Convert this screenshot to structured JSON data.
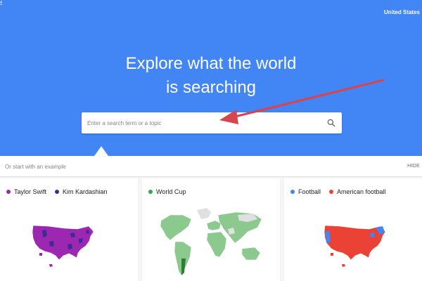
{
  "header": {
    "edge_text": "s",
    "country": "United States"
  },
  "hero": {
    "headline_line1": "Explore what the world",
    "headline_line2": "is searching"
  },
  "search": {
    "placeholder": "Enter a search term or a topic"
  },
  "examples": {
    "label": "Or start with an example",
    "hide_label": "HIDE"
  },
  "cards": [
    {
      "terms": [
        {
          "label": "Taylor Swift",
          "color": "#9c27b0"
        },
        {
          "label": "Kim Kardashian",
          "color": "#3f2b96"
        }
      ]
    },
    {
      "terms": [
        {
          "label": "World Cup",
          "color": "#34a853"
        }
      ]
    },
    {
      "terms": [
        {
          "label": "Football",
          "color": "#4285f4"
        },
        {
          "label": "American football",
          "color": "#ea4335"
        }
      ]
    }
  ],
  "colors": {
    "brand_blue": "#4285f4",
    "annotation_red": "#d64550"
  }
}
